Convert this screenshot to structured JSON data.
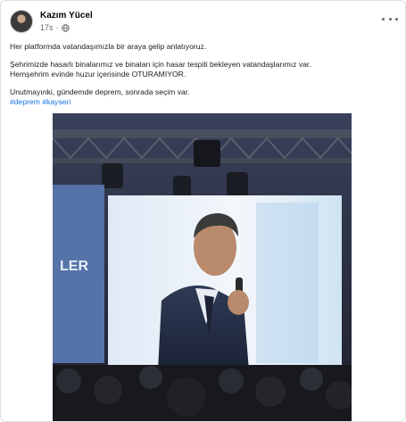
{
  "post": {
    "author": "Kazım Yücel",
    "time": "17s",
    "lines": [
      "Her platformda vatandaşımızla bir araya gelip anlatıyoruz.",
      "Şehrimizde hasarlı binalarımız ve binaları için hasar tespiti bekleyen vatandaşlarımız var.",
      "Hemşehrim evinde huzur içerisinde OTURAMIYOR.",
      "Unutmayınki, gündemde deprem, sonrada seçim var."
    ],
    "hashtags": [
      "#deprem",
      "#kayseri"
    ],
    "icons": {
      "avatar": "profile-photo",
      "privacy": "globe-icon",
      "menu": "more-options-icon"
    },
    "colors": {
      "link": "#1b74e4",
      "secondary_text": "#65676b"
    }
  },
  "photo": {
    "backdrop_text": "LER",
    "description_icon": "event-photo"
  }
}
